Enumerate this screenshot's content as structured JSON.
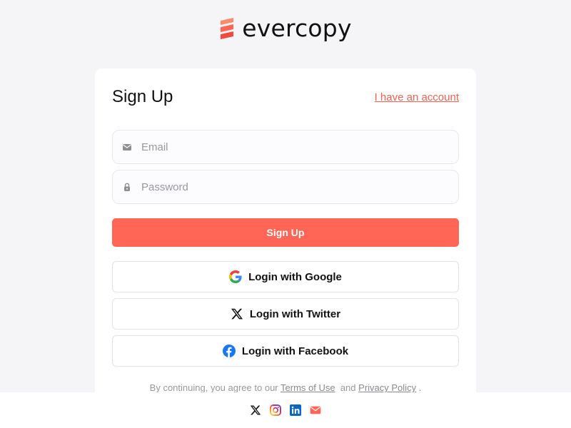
{
  "brand": {
    "name": "evercopy",
    "accent": "#ff6656",
    "link_color": "#ee6354"
  },
  "signup": {
    "title": "Sign Up",
    "account_link": "I have an account",
    "email": {
      "placeholder": "Email",
      "icon": "mail-icon"
    },
    "password": {
      "placeholder": "Password",
      "icon": "lock-icon"
    },
    "submit_label": "Sign Up",
    "social": [
      {
        "label": "Login with Google",
        "icon": "google-icon"
      },
      {
        "label": "Login with Twitter",
        "icon": "x-twitter-icon"
      },
      {
        "label": "Login with Facebook",
        "icon": "facebook-icon"
      }
    ],
    "terms": {
      "prefix": "By continuing, you agree to our",
      "terms_link": "Terms of Use",
      "and": "and",
      "privacy_link": "Privacy Policy",
      "suffix": "."
    }
  },
  "footer": {
    "icons": [
      "x-twitter-icon",
      "instagram-icon",
      "linkedin-icon",
      "mail-icon"
    ]
  }
}
